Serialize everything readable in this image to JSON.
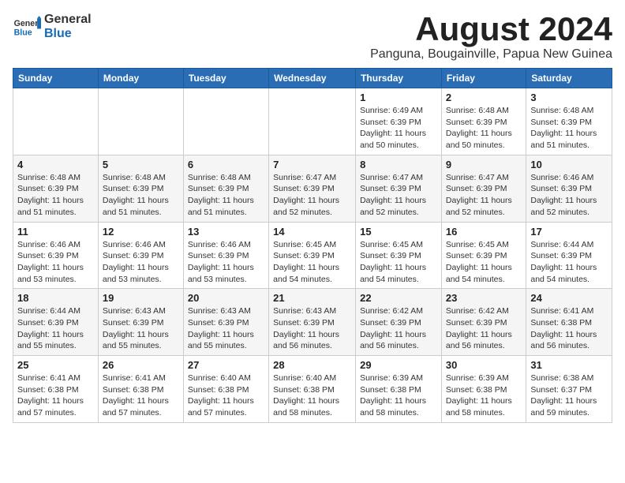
{
  "logo": {
    "text_general": "General",
    "text_blue": "Blue"
  },
  "title": {
    "month_year": "August 2024",
    "location": "Panguna, Bougainville, Papua New Guinea"
  },
  "days_of_week": [
    "Sunday",
    "Monday",
    "Tuesday",
    "Wednesday",
    "Thursday",
    "Friday",
    "Saturday"
  ],
  "weeks": [
    [
      {
        "day": "",
        "info": ""
      },
      {
        "day": "",
        "info": ""
      },
      {
        "day": "",
        "info": ""
      },
      {
        "day": "",
        "info": ""
      },
      {
        "day": "1",
        "info": "Sunrise: 6:49 AM\nSunset: 6:39 PM\nDaylight: 11 hours\nand 50 minutes."
      },
      {
        "day": "2",
        "info": "Sunrise: 6:48 AM\nSunset: 6:39 PM\nDaylight: 11 hours\nand 50 minutes."
      },
      {
        "day": "3",
        "info": "Sunrise: 6:48 AM\nSunset: 6:39 PM\nDaylight: 11 hours\nand 51 minutes."
      }
    ],
    [
      {
        "day": "4",
        "info": "Sunrise: 6:48 AM\nSunset: 6:39 PM\nDaylight: 11 hours\nand 51 minutes."
      },
      {
        "day": "5",
        "info": "Sunrise: 6:48 AM\nSunset: 6:39 PM\nDaylight: 11 hours\nand 51 minutes."
      },
      {
        "day": "6",
        "info": "Sunrise: 6:48 AM\nSunset: 6:39 PM\nDaylight: 11 hours\nand 51 minutes."
      },
      {
        "day": "7",
        "info": "Sunrise: 6:47 AM\nSunset: 6:39 PM\nDaylight: 11 hours\nand 52 minutes."
      },
      {
        "day": "8",
        "info": "Sunrise: 6:47 AM\nSunset: 6:39 PM\nDaylight: 11 hours\nand 52 minutes."
      },
      {
        "day": "9",
        "info": "Sunrise: 6:47 AM\nSunset: 6:39 PM\nDaylight: 11 hours\nand 52 minutes."
      },
      {
        "day": "10",
        "info": "Sunrise: 6:46 AM\nSunset: 6:39 PM\nDaylight: 11 hours\nand 52 minutes."
      }
    ],
    [
      {
        "day": "11",
        "info": "Sunrise: 6:46 AM\nSunset: 6:39 PM\nDaylight: 11 hours\nand 53 minutes."
      },
      {
        "day": "12",
        "info": "Sunrise: 6:46 AM\nSunset: 6:39 PM\nDaylight: 11 hours\nand 53 minutes."
      },
      {
        "day": "13",
        "info": "Sunrise: 6:46 AM\nSunset: 6:39 PM\nDaylight: 11 hours\nand 53 minutes."
      },
      {
        "day": "14",
        "info": "Sunrise: 6:45 AM\nSunset: 6:39 PM\nDaylight: 11 hours\nand 54 minutes."
      },
      {
        "day": "15",
        "info": "Sunrise: 6:45 AM\nSunset: 6:39 PM\nDaylight: 11 hours\nand 54 minutes."
      },
      {
        "day": "16",
        "info": "Sunrise: 6:45 AM\nSunset: 6:39 PM\nDaylight: 11 hours\nand 54 minutes."
      },
      {
        "day": "17",
        "info": "Sunrise: 6:44 AM\nSunset: 6:39 PM\nDaylight: 11 hours\nand 54 minutes."
      }
    ],
    [
      {
        "day": "18",
        "info": "Sunrise: 6:44 AM\nSunset: 6:39 PM\nDaylight: 11 hours\nand 55 minutes."
      },
      {
        "day": "19",
        "info": "Sunrise: 6:43 AM\nSunset: 6:39 PM\nDaylight: 11 hours\nand 55 minutes."
      },
      {
        "day": "20",
        "info": "Sunrise: 6:43 AM\nSunset: 6:39 PM\nDaylight: 11 hours\nand 55 minutes."
      },
      {
        "day": "21",
        "info": "Sunrise: 6:43 AM\nSunset: 6:39 PM\nDaylight: 11 hours\nand 56 minutes."
      },
      {
        "day": "22",
        "info": "Sunrise: 6:42 AM\nSunset: 6:39 PM\nDaylight: 11 hours\nand 56 minutes."
      },
      {
        "day": "23",
        "info": "Sunrise: 6:42 AM\nSunset: 6:39 PM\nDaylight: 11 hours\nand 56 minutes."
      },
      {
        "day": "24",
        "info": "Sunrise: 6:41 AM\nSunset: 6:38 PM\nDaylight: 11 hours\nand 56 minutes."
      }
    ],
    [
      {
        "day": "25",
        "info": "Sunrise: 6:41 AM\nSunset: 6:38 PM\nDaylight: 11 hours\nand 57 minutes."
      },
      {
        "day": "26",
        "info": "Sunrise: 6:41 AM\nSunset: 6:38 PM\nDaylight: 11 hours\nand 57 minutes."
      },
      {
        "day": "27",
        "info": "Sunrise: 6:40 AM\nSunset: 6:38 PM\nDaylight: 11 hours\nand 57 minutes."
      },
      {
        "day": "28",
        "info": "Sunrise: 6:40 AM\nSunset: 6:38 PM\nDaylight: 11 hours\nand 58 minutes."
      },
      {
        "day": "29",
        "info": "Sunrise: 6:39 AM\nSunset: 6:38 PM\nDaylight: 11 hours\nand 58 minutes."
      },
      {
        "day": "30",
        "info": "Sunrise: 6:39 AM\nSunset: 6:38 PM\nDaylight: 11 hours\nand 58 minutes."
      },
      {
        "day": "31",
        "info": "Sunrise: 6:38 AM\nSunset: 6:37 PM\nDaylight: 11 hours\nand 59 minutes."
      }
    ]
  ]
}
